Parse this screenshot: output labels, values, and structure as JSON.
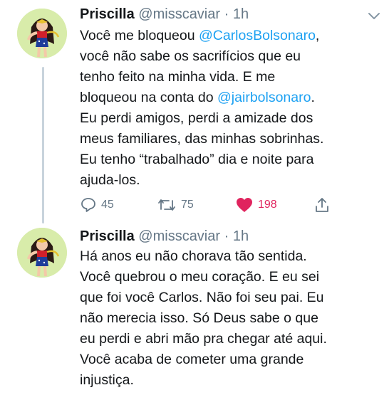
{
  "tweets": [
    {
      "name": "Priscilla",
      "handle": "@misscaviar",
      "separator": "·",
      "time": "1h",
      "lines": [
        [
          "Você me bloqueou ",
          {
            "mention": "@CarlosBolsonaro"
          },
          ","
        ],
        [
          "você não sabe os sacrifícios que eu"
        ],
        [
          "tenho feito na minha vida. E me"
        ],
        [
          "bloqueou na conta do ",
          {
            "mention": "@jairbolsonaro"
          },
          "."
        ],
        [
          "Eu perdi amigos, perdi a amizade dos"
        ],
        [
          "meus familiares, das minhas sobrinhas."
        ],
        [
          "Eu tenho “trabalhado” dia e noite para"
        ],
        [
          "ajuda-los."
        ]
      ],
      "reply_count": "45",
      "retweet_count": "75",
      "like_count": "198"
    },
    {
      "name": "Priscilla",
      "handle": "@misscaviar",
      "separator": "·",
      "time": "1h",
      "lines": [
        [
          "Há anos eu não chorava tão sentida."
        ],
        [
          "Você quebrou o meu coração. E eu sei"
        ],
        [
          "que foi você Carlos. Não foi seu pai. Eu"
        ],
        [
          "não merecia isso. Só Deus sabe o que"
        ],
        [
          "eu perdi e abri mão pra chegar até aqui."
        ],
        [
          "Você acaba de cometer uma grande"
        ],
        [
          "injustiça."
        ]
      ]
    }
  ],
  "colors": {
    "text": "#14171a",
    "secondary": "#657786",
    "mention": "#1da1f2",
    "like": "#e0245e",
    "thread_line": "#c8d3dc"
  },
  "icons": [
    "chevron-down-icon",
    "reply-icon",
    "retweet-icon",
    "heart-icon",
    "share-icon"
  ]
}
